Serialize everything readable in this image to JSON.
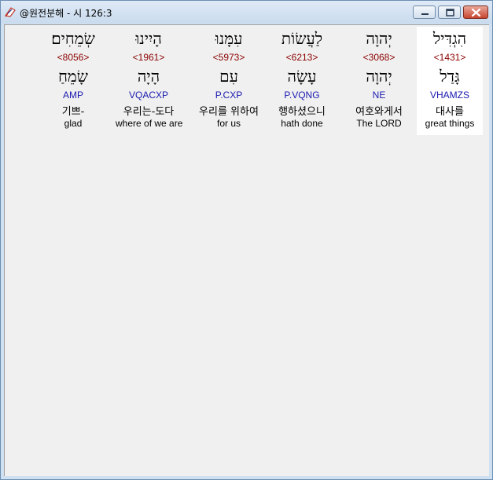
{
  "window": {
    "title": "@원전분해 - 시 126:3"
  },
  "words": [
    {
      "hebrew": "שְׂמֵחִים׃",
      "strong": "<8056>",
      "lemma": "שָׂמֵחַ",
      "morph": "AMP",
      "korean": "기쁘-",
      "english": "glad"
    },
    {
      "hebrew": "הָיִינוּ",
      "strong": "<1961>",
      "lemma": "הָיָה",
      "morph": "VQACXP",
      "korean": "우리는-도다",
      "english": "where of we are"
    },
    {
      "hebrew": "עִמָּנוּ",
      "strong": "<5973>",
      "lemma": "עִם",
      "morph": "P.CXP",
      "korean": "우리를 위하여",
      "english": "for us"
    },
    {
      "hebrew": "לַעֲשׂוֹת",
      "strong": "<6213>",
      "lemma": "עָשָׂה",
      "morph": "P.VQNG",
      "korean": "행하셨으니",
      "english": "hath done"
    },
    {
      "hebrew": "יְהוָה",
      "strong": "<3068>",
      "lemma": "יְהוָה",
      "morph": "NE",
      "korean": "여호와게서",
      "english": "The LORD"
    },
    {
      "hebrew": "הִגְדִּיל",
      "strong": "<1431>",
      "lemma": "גָּדַל",
      "morph": "VHAMZS",
      "korean": "대사를",
      "english": "great things"
    }
  ]
}
